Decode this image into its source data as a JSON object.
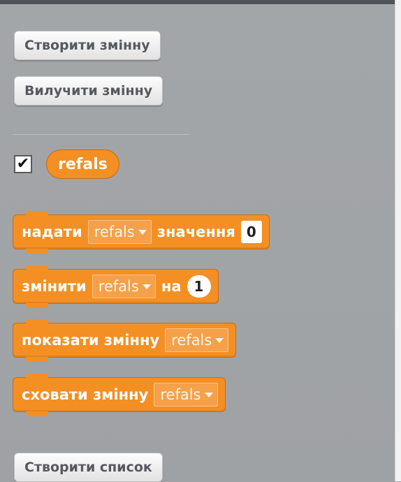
{
  "buttons": {
    "create_variable": "Створити змінну",
    "delete_variable": "Вилучити змінну",
    "create_list": "Створити список"
  },
  "variable": {
    "checked": true,
    "checkbox_glyph": "✔",
    "name": "refals"
  },
  "blocks": {
    "set": {
      "label": "надати",
      "var": "refals",
      "label2": "значення",
      "value": "0"
    },
    "change": {
      "label": "змінити",
      "var": "refals",
      "label2": "на",
      "value": "1"
    },
    "show": {
      "label": "показати змінну",
      "var": "refals"
    },
    "hide": {
      "label": "сховати змінну",
      "var": "refals"
    }
  },
  "colors": {
    "variables_orange": "#f48f23",
    "palette_gray": "#a0a3a6"
  }
}
